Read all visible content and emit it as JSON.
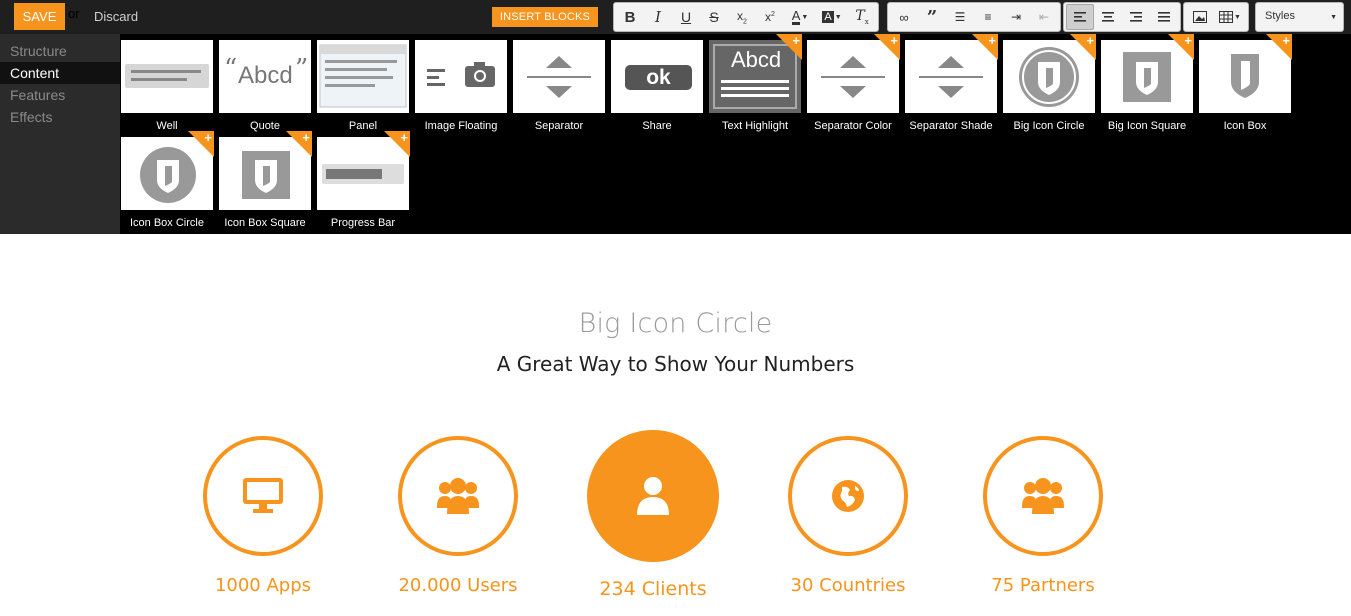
{
  "toolbar": {
    "save_label": "SAVE",
    "or_label": "or",
    "discard_label": "Discard",
    "insert_blocks_label": "INSERT BLOCKS",
    "styles_label": "Styles"
  },
  "sidebar": {
    "items": [
      {
        "label": "Structure",
        "active": false
      },
      {
        "label": "Content",
        "active": true
      },
      {
        "label": "Features",
        "active": false
      },
      {
        "label": "Effects",
        "active": false
      }
    ]
  },
  "blocks": [
    {
      "label": "Well",
      "icon": "well-icon",
      "new": false
    },
    {
      "label": "Quote",
      "icon": "quote-icon",
      "new": false
    },
    {
      "label": "Panel",
      "icon": "panel-icon",
      "new": false
    },
    {
      "label": "Image Floating",
      "icon": "image-floating-icon",
      "new": false
    },
    {
      "label": "Separator",
      "icon": "separator-icon",
      "new": false
    },
    {
      "label": "Share",
      "icon": "share-icon",
      "new": false
    },
    {
      "label": "Text Highlight",
      "icon": "text-highlight-icon",
      "new": true
    },
    {
      "label": "Separator Color",
      "icon": "separator-icon",
      "new": true
    },
    {
      "label": "Separator Shade",
      "icon": "separator-icon",
      "new": true
    },
    {
      "label": "Big Icon Circle",
      "icon": "shield-circle-icon",
      "new": true
    },
    {
      "label": "Big Icon Square",
      "icon": "shield-square-icon",
      "new": true
    },
    {
      "label": "Icon Box",
      "icon": "shield-icon",
      "new": true
    },
    {
      "label": "Icon Box Circle",
      "icon": "shield-circle-icon",
      "new": true
    },
    {
      "label": "Icon Box Square",
      "icon": "shield-square-icon",
      "new": true
    },
    {
      "label": "Progress Bar",
      "icon": "progress-bar-icon",
      "new": true
    }
  ],
  "thumb_text": {
    "quote": "Abcd",
    "share": "ok",
    "highlight": "Abcd"
  },
  "section": {
    "title": "Big Icon Circle",
    "subtitle": "A Great Way to Show Your Numbers"
  },
  "stats": [
    {
      "label": "1000 Apps",
      "icon": "desktop-icon",
      "highlighted": false
    },
    {
      "label": "20.000 Users",
      "icon": "users-icon",
      "highlighted": false
    },
    {
      "label": "234 Clients",
      "icon": "user-icon",
      "highlighted": true
    },
    {
      "label": "30 Countries",
      "icon": "globe-icon",
      "highlighted": false
    },
    {
      "label": "75 Partners",
      "icon": "users-icon",
      "highlighted": false
    }
  ],
  "colors": {
    "accent": "#f7941d",
    "toolbar_bg": "#1f1f1f",
    "panel_bg": "#000000",
    "sidebar_bg": "#2b2b2b"
  }
}
